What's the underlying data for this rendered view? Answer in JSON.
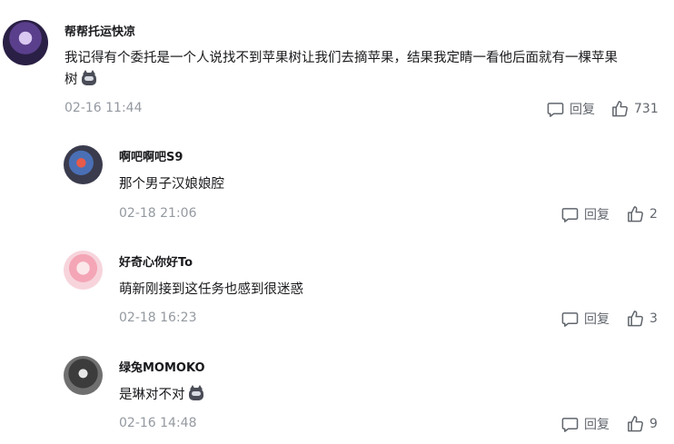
{
  "comment": {
    "username": "帮帮托运快凉",
    "text_line1": "我记得有个委托是一个人说找不到苹果树让我们去摘苹果，结果我定睛一看他后面就有一棵苹果",
    "text_line2": "树",
    "emote_icon": "cat-emote-icon",
    "time": "02-16 11:44",
    "reply_label": "回复",
    "like_count": "731"
  },
  "replies": [
    {
      "username": "啊吧啊吧S9",
      "text": "那个男子汉娘娘腔",
      "time": "02-18 21:06",
      "reply_label": "回复",
      "like_count": "2"
    },
    {
      "username": "好奇心你好To",
      "text": "萌新刚接到这任务也感到很迷惑",
      "time": "02-18 16:23",
      "reply_label": "回复",
      "like_count": "3"
    },
    {
      "username": "绿兔MOMOKO",
      "text": "是琳对不对",
      "emote_icon": "cat-emote-icon",
      "time": "02-16 14:48",
      "reply_label": "回复",
      "like_count": "9"
    }
  ]
}
